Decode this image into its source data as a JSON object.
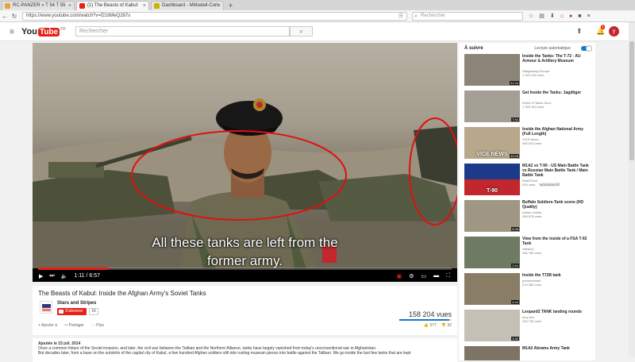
{
  "browser": {
    "tabs": [
      {
        "title": "RC-PANZER » T 54 T 55",
        "active": false,
        "icon": "rc-panzer-favicon",
        "color": "#e8a33c"
      },
      {
        "title": "(1) The Beasts of Kabul:",
        "active": true,
        "icon": "youtube-favicon",
        "color": "#e62117"
      },
      {
        "title": "Dashboard - MModell-Com",
        "active": false,
        "icon": "mmodell-favicon",
        "color": "#c9b400"
      }
    ],
    "url": "https://www.youtube.com/watch?v=f21tiMeQ287s",
    "search_placeholder": "Rechercher"
  },
  "youtube": {
    "logo_you": "You",
    "logo_tube": "Tube",
    "logo_country": "FR",
    "search_placeholder": "Rechercher",
    "notification_count": "1",
    "avatar_letter": "y"
  },
  "player": {
    "subtitle_line1": "All these tanks are left from the",
    "subtitle_line2": "former army.",
    "time": "1:11 / 6:57",
    "progress": 0.17
  },
  "video": {
    "title": "The Beasts of Kabul: Inside the Afghan Army's Soviet Tanks",
    "channel": "Stars and Stripes",
    "subscribe_label": "S'abonner",
    "subscriber_count": "1K",
    "views": "158 204 vues",
    "actions": {
      "add": "Ajouter à",
      "share": "Partager",
      "more": "Plus"
    },
    "likes": "577",
    "dislikes": "32",
    "published": "Ajoutée le 15 juil. 2014",
    "description_1": "Once a common fixture of the Soviet invasion, and later, the civil war between the Taliban and the Northern Alliance, tanks have largely vanished from today's unconventional war in Afghanistan.",
    "description_2": "But decades later, from a base on the outskirts of the capital city of Kabul, a few hundred Afghan soldiers still ride rusting museum pieces into battle against the Taliban. We go inside the last few tanks that are kept"
  },
  "sidebar": {
    "heading": "À suivre",
    "autoplay_label": "Lecture automatique",
    "items": [
      {
        "title": "Inside the Tanks: The T-72 - AU Armour & Artillery Museum",
        "channel": "Wargaming Europe",
        "views": "1 324 140 vues",
        "duration": "31:34"
      },
      {
        "title": "Get Inside the Tanks: Jagdtiger",
        "channel": "World of Tanks Xbox",
        "views": "1 325 343 vues",
        "duration": "7:54"
      },
      {
        "title": "Inside the Afghan National Army (Full Length)",
        "channel": "VICE News",
        "views": "945 613 vues",
        "duration": "43:28",
        "thumb_text": "VICE NEWS"
      },
      {
        "title": "M1A2 vs T-90 - US Main Battle Tank vs Russian Main Battle Tank / Main Battle Tank",
        "channel": "RealZTech",
        "views": "915 vues",
        "badge": "NOUVEAUTÉ",
        "duration": "",
        "thumb_text": "T-90"
      },
      {
        "title": "Buffalo Soldiers-Tank scene (HD Quality)",
        "channel": "Adrian Lesley",
        "views": "265 678 vues",
        "duration": "5:08"
      },
      {
        "title": "View from the inside of a FSA T-92 Tank",
        "channel": "rafeal12",
        "views": "184 789 vues",
        "duration": "2:54"
      },
      {
        "title": "Inside the T72B tank",
        "channel": "panzerdealer",
        "views": "274 380 vues",
        "duration": "4:44"
      },
      {
        "title": "Leopard2 TANK landing rounds",
        "channel": "tony kim",
        "views": "324 735 vues",
        "duration": "1:41"
      },
      {
        "title": "M1A2 Abrams Army Tank",
        "channel": "",
        "views": "",
        "duration": ""
      }
    ]
  },
  "colors": {
    "accent": "#e62117",
    "link_blue": "#167ac6",
    "annotation": "#e01010"
  }
}
